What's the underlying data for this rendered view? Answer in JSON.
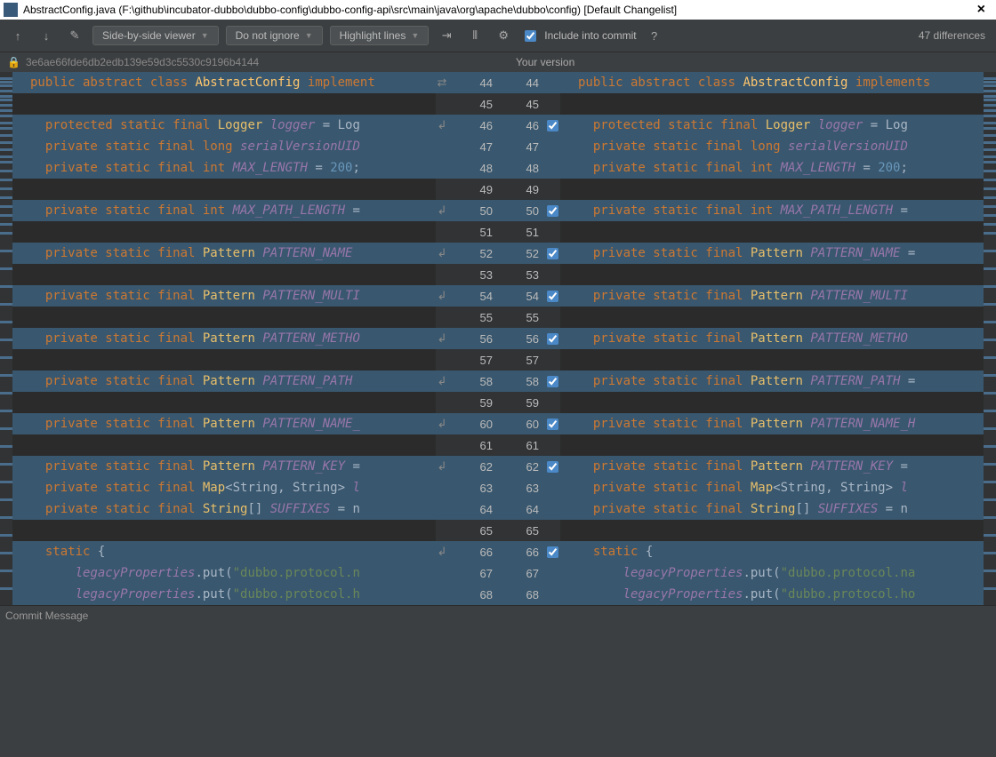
{
  "title": "AbstractConfig.java (F:\\github\\incubator-dubbo\\dubbo-config\\dubbo-config-api\\src\\main\\java\\org\\apache\\dubbo\\config) [Default Changelist]",
  "toolbar": {
    "viewer": "Side-by-side viewer",
    "ignore": "Do not ignore",
    "highlight": "Highlight lines",
    "include": "Include into commit",
    "diffcount": "47 differences"
  },
  "hash": "3e6ae66fde6db2edb139e59d3c5530c9196b4144",
  "yourversion": "Your version",
  "commitmsg": "Commit Message",
  "left_lines": [
    {
      "n": 44,
      "cls": "hl-mod",
      "arrow": "⇄",
      "tokens": [
        [
          "kw",
          "public abstract class"
        ],
        [
          "op",
          " "
        ],
        [
          "cls",
          "AbstractConfig"
        ],
        [
          "op",
          " "
        ],
        [
          "kw",
          "implement"
        ]
      ]
    },
    {
      "n": 45,
      "cls": "",
      "tokens": []
    },
    {
      "n": 46,
      "cls": "hl-mod",
      "arrow": "↲",
      "tokens": [
        [
          "op",
          "  "
        ],
        [
          "kw",
          "protected static final"
        ],
        [
          "op",
          " "
        ],
        [
          "typ2",
          "Logger"
        ],
        [
          "op",
          " "
        ],
        [
          "fld",
          "logger"
        ],
        [
          "op",
          " = Log"
        ]
      ]
    },
    {
      "n": 47,
      "cls": "hl-mod",
      "tokens": [
        [
          "op",
          "  "
        ],
        [
          "kw",
          "private static final long"
        ],
        [
          "op",
          " "
        ],
        [
          "fld",
          "serialVersionUID"
        ]
      ]
    },
    {
      "n": 48,
      "cls": "hl-mod",
      "tokens": [
        [
          "op",
          "  "
        ],
        [
          "kw",
          "private static final int"
        ],
        [
          "op",
          " "
        ],
        [
          "fld",
          "MAX_LENGTH"
        ],
        [
          "op",
          " = "
        ],
        [
          "num",
          "200"
        ],
        [
          "op",
          ";"
        ]
      ]
    },
    {
      "n": 49,
      "cls": "",
      "tokens": []
    },
    {
      "n": 50,
      "cls": "hl-mod",
      "arrow": "↲",
      "tokens": [
        [
          "op",
          "  "
        ],
        [
          "kw",
          "private static final int"
        ],
        [
          "op",
          " "
        ],
        [
          "fld",
          "MAX_PATH_LENGTH"
        ],
        [
          "op",
          " ="
        ]
      ]
    },
    {
      "n": 51,
      "cls": "",
      "tokens": []
    },
    {
      "n": 52,
      "cls": "hl-mod",
      "arrow": "↲",
      "tokens": [
        [
          "op",
          "  "
        ],
        [
          "kw",
          "private static final"
        ],
        [
          "op",
          " "
        ],
        [
          "typ2",
          "Pattern"
        ],
        [
          "op",
          " "
        ],
        [
          "fld",
          "PATTERN_NAME"
        ]
      ]
    },
    {
      "n": 53,
      "cls": "",
      "tokens": []
    },
    {
      "n": 54,
      "cls": "hl-mod",
      "arrow": "↲",
      "tokens": [
        [
          "op",
          "  "
        ],
        [
          "kw",
          "private static final"
        ],
        [
          "op",
          " "
        ],
        [
          "typ2",
          "Pattern"
        ],
        [
          "op",
          " "
        ],
        [
          "fld",
          "PATTERN_MULTI"
        ]
      ]
    },
    {
      "n": 55,
      "cls": "",
      "tokens": []
    },
    {
      "n": 56,
      "cls": "hl-mod",
      "arrow": "↲",
      "tokens": [
        [
          "op",
          "  "
        ],
        [
          "kw",
          "private static final"
        ],
        [
          "op",
          " "
        ],
        [
          "typ2",
          "Pattern"
        ],
        [
          "op",
          " "
        ],
        [
          "fld",
          "PATTERN_METHO"
        ]
      ]
    },
    {
      "n": 57,
      "cls": "",
      "tokens": []
    },
    {
      "n": 58,
      "cls": "hl-mod",
      "arrow": "↲",
      "tokens": [
        [
          "op",
          "  "
        ],
        [
          "kw",
          "private static final"
        ],
        [
          "op",
          " "
        ],
        [
          "typ2",
          "Pattern"
        ],
        [
          "op",
          " "
        ],
        [
          "fld",
          "PATTERN_PATH"
        ]
      ]
    },
    {
      "n": 59,
      "cls": "",
      "tokens": []
    },
    {
      "n": 60,
      "cls": "hl-mod",
      "arrow": "↲",
      "tokens": [
        [
          "op",
          "  "
        ],
        [
          "kw",
          "private static final"
        ],
        [
          "op",
          " "
        ],
        [
          "typ2",
          "Pattern"
        ],
        [
          "op",
          " "
        ],
        [
          "fld",
          "PATTERN_NAME_"
        ]
      ]
    },
    {
      "n": 61,
      "cls": "",
      "tokens": []
    },
    {
      "n": 62,
      "cls": "hl-mod",
      "arrow": "↲",
      "tokens": [
        [
          "op",
          "  "
        ],
        [
          "kw",
          "private static final"
        ],
        [
          "op",
          " "
        ],
        [
          "typ2",
          "Pattern"
        ],
        [
          "op",
          " "
        ],
        [
          "fld",
          "PATTERN_KEY"
        ],
        [
          "op",
          " ="
        ]
      ]
    },
    {
      "n": 63,
      "cls": "hl-mod",
      "tokens": [
        [
          "op",
          "  "
        ],
        [
          "kw",
          "private static final"
        ],
        [
          "op",
          " "
        ],
        [
          "typ2",
          "Map"
        ],
        [
          "gen",
          "<String, String>"
        ],
        [
          "op",
          " "
        ],
        [
          "fld",
          "l"
        ]
      ]
    },
    {
      "n": 64,
      "cls": "hl-mod",
      "tokens": [
        [
          "op",
          "  "
        ],
        [
          "kw",
          "private static final"
        ],
        [
          "op",
          " "
        ],
        [
          "typ2",
          "String"
        ],
        [
          "op",
          "[] "
        ],
        [
          "fld",
          "SUFFIXES"
        ],
        [
          "op",
          " = n"
        ]
      ]
    },
    {
      "n": 65,
      "cls": "",
      "tokens": []
    },
    {
      "n": 66,
      "cls": "hl-mod",
      "arrow": "↲",
      "tokens": [
        [
          "op",
          "  "
        ],
        [
          "kw",
          "static"
        ],
        [
          "op",
          " {"
        ]
      ]
    },
    {
      "n": 67,
      "cls": "hl-mod",
      "tokens": [
        [
          "op",
          "      "
        ],
        [
          "fld",
          "legacyProperties"
        ],
        [
          "op",
          ".put("
        ],
        [
          "str",
          "\"dubbo.protocol.n"
        ]
      ]
    },
    {
      "n": 68,
      "cls": "hl-mod",
      "tokens": [
        [
          "op",
          "      "
        ],
        [
          "fld",
          "legacyProperties"
        ],
        [
          "op",
          ".put("
        ],
        [
          "str",
          "\"dubbo.protocol.h"
        ]
      ]
    }
  ],
  "right_lines": [
    {
      "n": 44,
      "cls": "hl-mod",
      "arrow": "⇄",
      "tokens": [
        [
          "kw",
          "public abstract class"
        ],
        [
          "op",
          " "
        ],
        [
          "cls",
          "AbstractConfig"
        ],
        [
          "op",
          " "
        ],
        [
          "kw",
          "implements"
        ]
      ]
    },
    {
      "n": 45,
      "cls": "",
      "tokens": []
    },
    {
      "n": 46,
      "cls": "hl-mod",
      "chk": true,
      "tokens": [
        [
          "op",
          "  "
        ],
        [
          "kw",
          "protected static final"
        ],
        [
          "op",
          " "
        ],
        [
          "typ2",
          "Logger"
        ],
        [
          "op",
          " "
        ],
        [
          "fld",
          "logger"
        ],
        [
          "op",
          " = Log"
        ]
      ]
    },
    {
      "n": 47,
      "cls": "hl-mod",
      "tokens": [
        [
          "op",
          "  "
        ],
        [
          "kw",
          "private static final long"
        ],
        [
          "op",
          " "
        ],
        [
          "fld",
          "serialVersionUID"
        ]
      ]
    },
    {
      "n": 48,
      "cls": "hl-mod",
      "tokens": [
        [
          "op",
          "  "
        ],
        [
          "kw",
          "private static final int"
        ],
        [
          "op",
          " "
        ],
        [
          "fld",
          "MAX_LENGTH"
        ],
        [
          "op",
          " = "
        ],
        [
          "num",
          "200"
        ],
        [
          "op",
          ";"
        ]
      ]
    },
    {
      "n": 49,
      "cls": "",
      "tokens": []
    },
    {
      "n": 50,
      "cls": "hl-mod",
      "chk": true,
      "tokens": [
        [
          "op",
          "  "
        ],
        [
          "kw",
          "private static final int"
        ],
        [
          "op",
          " "
        ],
        [
          "fld",
          "MAX_PATH_LENGTH"
        ],
        [
          "op",
          " ="
        ]
      ]
    },
    {
      "n": 51,
      "cls": "",
      "tokens": []
    },
    {
      "n": 52,
      "cls": "hl-mod",
      "chk": true,
      "tokens": [
        [
          "op",
          "  "
        ],
        [
          "kw",
          "private static final"
        ],
        [
          "op",
          " "
        ],
        [
          "typ2",
          "Pattern"
        ],
        [
          "op",
          " "
        ],
        [
          "fld",
          "PATTERN_NAME"
        ],
        [
          "op",
          " ="
        ]
      ]
    },
    {
      "n": 53,
      "cls": "",
      "tokens": []
    },
    {
      "n": 54,
      "cls": "hl-mod",
      "chk": true,
      "tokens": [
        [
          "op",
          "  "
        ],
        [
          "kw",
          "private static final"
        ],
        [
          "op",
          " "
        ],
        [
          "typ2",
          "Pattern"
        ],
        [
          "op",
          " "
        ],
        [
          "fld",
          "PATTERN_MULTI"
        ]
      ]
    },
    {
      "n": 55,
      "cls": "",
      "tokens": []
    },
    {
      "n": 56,
      "cls": "hl-mod",
      "chk": true,
      "tokens": [
        [
          "op",
          "  "
        ],
        [
          "kw",
          "private static final"
        ],
        [
          "op",
          " "
        ],
        [
          "typ2",
          "Pattern"
        ],
        [
          "op",
          " "
        ],
        [
          "fld",
          "PATTERN_METHO"
        ]
      ]
    },
    {
      "n": 57,
      "cls": "",
      "tokens": []
    },
    {
      "n": 58,
      "cls": "hl-mod",
      "chk": true,
      "tokens": [
        [
          "op",
          "  "
        ],
        [
          "kw",
          "private static final"
        ],
        [
          "op",
          " "
        ],
        [
          "typ2",
          "Pattern"
        ],
        [
          "op",
          " "
        ],
        [
          "fld",
          "PATTERN_PATH"
        ],
        [
          "op",
          " ="
        ]
      ]
    },
    {
      "n": 59,
      "cls": "",
      "tokens": []
    },
    {
      "n": 60,
      "cls": "hl-mod",
      "chk": true,
      "tokens": [
        [
          "op",
          "  "
        ],
        [
          "kw",
          "private static final"
        ],
        [
          "op",
          " "
        ],
        [
          "typ2",
          "Pattern"
        ],
        [
          "op",
          " "
        ],
        [
          "fld",
          "PATTERN_NAME_H"
        ]
      ]
    },
    {
      "n": 61,
      "cls": "",
      "tokens": []
    },
    {
      "n": 62,
      "cls": "hl-mod",
      "chk": true,
      "tokens": [
        [
          "op",
          "  "
        ],
        [
          "kw",
          "private static final"
        ],
        [
          "op",
          " "
        ],
        [
          "typ2",
          "Pattern"
        ],
        [
          "op",
          " "
        ],
        [
          "fld",
          "PATTERN_KEY"
        ],
        [
          "op",
          " ="
        ]
      ]
    },
    {
      "n": 63,
      "cls": "hl-mod",
      "tokens": [
        [
          "op",
          "  "
        ],
        [
          "kw",
          "private static final"
        ],
        [
          "op",
          " "
        ],
        [
          "typ2",
          "Map"
        ],
        [
          "gen",
          "<String, String>"
        ],
        [
          "op",
          " "
        ],
        [
          "fld",
          "l"
        ]
      ]
    },
    {
      "n": 64,
      "cls": "hl-mod",
      "tokens": [
        [
          "op",
          "  "
        ],
        [
          "kw",
          "private static final"
        ],
        [
          "op",
          " "
        ],
        [
          "typ2",
          "String"
        ],
        [
          "op",
          "[] "
        ],
        [
          "fld",
          "SUFFIXES"
        ],
        [
          "op",
          " = n"
        ]
      ]
    },
    {
      "n": 65,
      "cls": "",
      "tokens": []
    },
    {
      "n": 66,
      "cls": "hl-mod",
      "chk": true,
      "tokens": [
        [
          "op",
          "  "
        ],
        [
          "kw",
          "static"
        ],
        [
          "op",
          " {"
        ]
      ]
    },
    {
      "n": 67,
      "cls": "hl-mod",
      "tokens": [
        [
          "op",
          "      "
        ],
        [
          "fld",
          "legacyProperties"
        ],
        [
          "op",
          ".put("
        ],
        [
          "str",
          "\"dubbo.protocol.na"
        ]
      ]
    },
    {
      "n": 68,
      "cls": "hl-mod",
      "tokens": [
        [
          "op",
          "      "
        ],
        [
          "fld",
          "legacyProperties"
        ],
        [
          "op",
          ".put("
        ],
        [
          "str",
          "\"dubbo.protocol.ho"
        ]
      ]
    }
  ],
  "minimap_marks": [
    6,
    10,
    14,
    20,
    26,
    30,
    36,
    42,
    48,
    56,
    62,
    70,
    78,
    86,
    94,
    100,
    110,
    120,
    130,
    140,
    150,
    160,
    170,
    180,
    200,
    220,
    240,
    260,
    280,
    300,
    320,
    340,
    360,
    380,
    400,
    420,
    440,
    460,
    480,
    500,
    520,
    540,
    560,
    580
  ]
}
